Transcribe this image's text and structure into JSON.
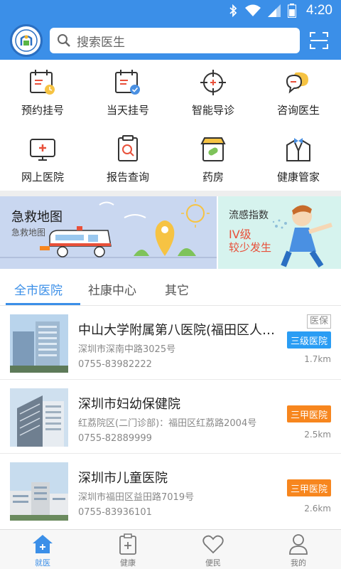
{
  "status_bar": {
    "time": "4:20"
  },
  "header": {
    "search_placeholder": "搜索医生"
  },
  "features": [
    {
      "label": "预约挂号",
      "icon": "calendar-clock-icon"
    },
    {
      "label": "当天挂号",
      "icon": "calendar-check-icon"
    },
    {
      "label": "智能导诊",
      "icon": "crosshair-icon"
    },
    {
      "label": "咨询医生",
      "icon": "chat-bubbles-icon"
    },
    {
      "label": "网上医院",
      "icon": "monitor-cross-icon"
    },
    {
      "label": "报告查询",
      "icon": "report-search-icon"
    },
    {
      "label": "药房",
      "icon": "pharmacy-icon"
    },
    {
      "label": "健康管家",
      "icon": "butler-icon"
    }
  ],
  "banners": {
    "left": {
      "title": "急救地图",
      "subtitle": "急救地图"
    },
    "right": {
      "title": "流感指数",
      "level": "IV级",
      "desc": "较少发生"
    }
  },
  "tabs": [
    "全市医院",
    "社康中心",
    "其它"
  ],
  "active_tab": 0,
  "hospitals": [
    {
      "name": "中山大学附属第八医院(福田区人民医院)",
      "address": "深圳市深南中路3025号",
      "phone": "0755-83982222",
      "level": "三级医院",
      "level_color": "#2a9df4",
      "distance": "1.7km",
      "insurance": "医保"
    },
    {
      "name": "深圳市妇幼保健院",
      "address": "红荔院区(二门诊部)：福田区红荔路2004号",
      "phone": "0755-82889999",
      "level": "三甲医院",
      "level_color": "#f7861e",
      "distance": "2.5km"
    },
    {
      "name": "深圳市儿童医院",
      "address": "深圳市福田区益田路7019号",
      "phone": "0755-83936101",
      "level": "三甲医院",
      "level_color": "#f7861e",
      "distance": "2.6km"
    }
  ],
  "bottom_nav": [
    {
      "label": "就医",
      "icon": "home-icon"
    },
    {
      "label": "健康",
      "icon": "clipboard-plus-icon"
    },
    {
      "label": "便民",
      "icon": "heart-icon"
    },
    {
      "label": "我的",
      "icon": "person-icon"
    }
  ],
  "active_nav": 0,
  "colors": {
    "primary": "#3b8fe8",
    "accent_orange": "#f7861e",
    "accent_blue": "#2a9df4"
  }
}
